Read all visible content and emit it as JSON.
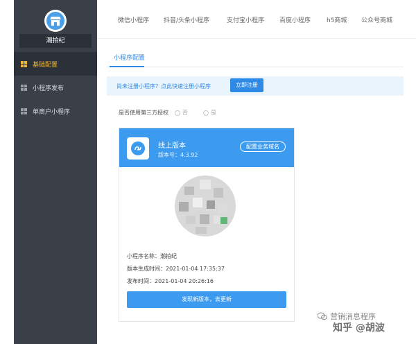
{
  "sidebar": {
    "shop_name": "潮拍纪",
    "items": [
      {
        "label": "基础配置",
        "active": true
      },
      {
        "label": "小程序发布",
        "active": false
      },
      {
        "label": "单商户小程序",
        "active": false
      }
    ]
  },
  "topnav": {
    "items": [
      "微信小程序",
      "抖音/头条小程序",
      "支付宝小程序",
      "百度小程序",
      "h5商城",
      "公众号商城"
    ]
  },
  "tabs": {
    "active": "小程序配置"
  },
  "notice": {
    "text": "尚未注册小程序？点此快速注册小程序",
    "button": "立即注册"
  },
  "auth": {
    "label": "是否使用第三方授权",
    "option_no": "否",
    "option_yes": "是"
  },
  "card": {
    "title": "线上版本",
    "version": "版本号：4.3.92",
    "domain_button": "配置业务域名",
    "name_line": "小程序名称：潮拍纪",
    "generated_line": "版本生成时间：2021-01-04 17:35:37",
    "published_line": "发布时间：2021-01-04 20:26:16",
    "update_button": "发现新版本，去更新"
  },
  "watermark": {
    "account": "营销消息程序",
    "zhihu": "知乎 @胡波"
  },
  "colors": {
    "sidebar": "#3a3f48",
    "accent": "#3c9bef",
    "active_menu": "#f5b82e"
  }
}
